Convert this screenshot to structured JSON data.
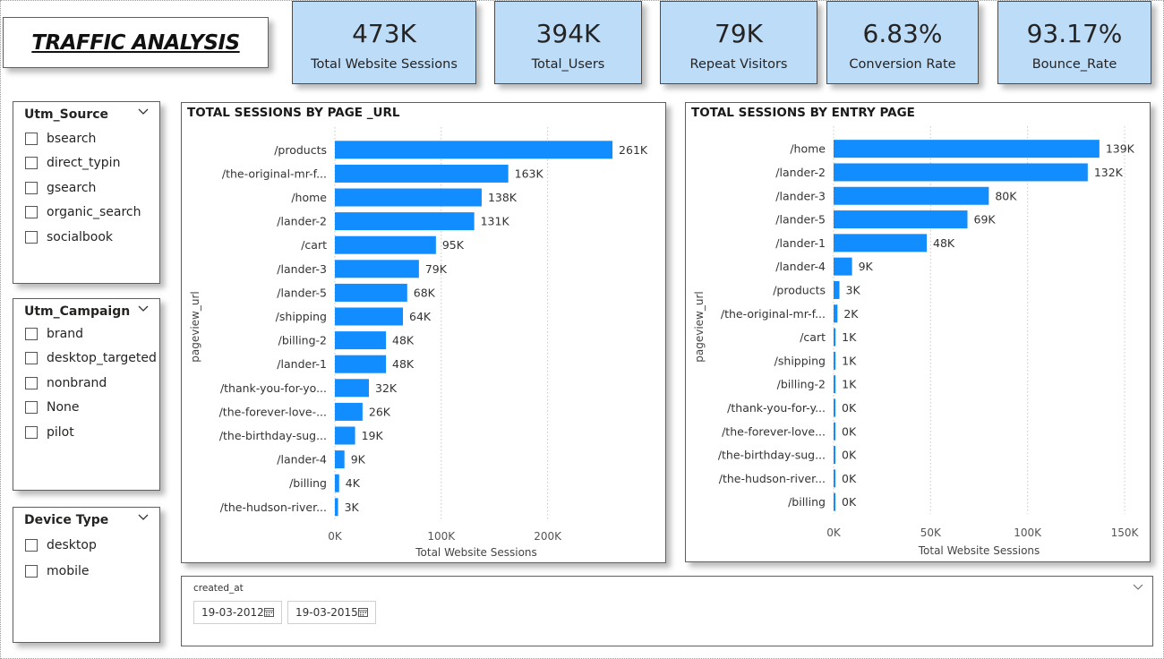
{
  "title": "TRAFFIC ANALYSIS",
  "kpis": [
    {
      "value": "473K",
      "label": "Total Website Sessions"
    },
    {
      "value": "394K",
      "label": "Total_Users"
    },
    {
      "value": "79K",
      "label": "Repeat Visitors"
    },
    {
      "value": "6.83%",
      "label": "Conversion Rate"
    },
    {
      "value": "93.17%",
      "label": "Bounce_Rate"
    }
  ],
  "slicers": {
    "utm_source": {
      "title": "Utm_Source",
      "items": [
        "bsearch",
        "direct_typin",
        "gsearch",
        "organic_search",
        "socialbook"
      ]
    },
    "utm_campaign": {
      "title": "Utm_Campaign",
      "items": [
        "brand",
        "desktop_targeted",
        "nonbrand",
        "None",
        "pilot"
      ]
    },
    "device_type": {
      "title": "Device Type",
      "items": [
        "desktop",
        "mobile"
      ]
    }
  },
  "date_filter": {
    "label": "created_at",
    "start": "19-03-2012",
    "end": "19-03-2015"
  },
  "colors": {
    "bar": "#118dff",
    "kpi_bg": "#bcdcf8"
  },
  "chart_data": [
    {
      "type": "bar",
      "orientation": "horizontal",
      "title": "TOTAL SESSIONS BY PAGE _URL",
      "xlabel": "Total Website Sessions",
      "ylabel": "pageview_url",
      "xlim": [
        0,
        266000
      ],
      "xticks": [
        0,
        100000,
        200000
      ],
      "xtick_labels": [
        "0K",
        "100K",
        "200K"
      ],
      "grid": true,
      "categories": [
        "/products",
        "/the-original-mr-f...",
        "/home",
        "/lander-2",
        "/cart",
        "/lander-3",
        "/lander-5",
        "/shipping",
        "/billing-2",
        "/lander-1",
        "/thank-you-for-yo...",
        "/the-forever-love-...",
        "/the-birthday-sug...",
        "/lander-4",
        "/billing",
        "/the-hudson-river..."
      ],
      "values": [
        261000,
        163000,
        138000,
        131000,
        95000,
        79000,
        68000,
        64000,
        48000,
        48000,
        32000,
        26000,
        19000,
        9000,
        4000,
        3000
      ],
      "data_labels": [
        "261K",
        "163K",
        "138K",
        "131K",
        "95K",
        "79K",
        "68K",
        "64K",
        "48K",
        "48K",
        "32K",
        "26K",
        "19K",
        "9K",
        "4K",
        "3K"
      ]
    },
    {
      "type": "bar",
      "orientation": "horizontal",
      "title": "TOTAL SESSIONS BY ENTRY PAGE",
      "xlabel": "Total Website Sessions",
      "ylabel": "pageview_url",
      "xlim": [
        0,
        150000
      ],
      "xticks": [
        0,
        50000,
        100000,
        150000
      ],
      "xtick_labels": [
        "0K",
        "50K",
        "100K",
        "150K"
      ],
      "grid": true,
      "categories": [
        "/home",
        "/lander-2",
        "/lander-3",
        "/lander-5",
        "/lander-1",
        "/lander-4",
        "/products",
        "/the-original-mr-f...",
        "/cart",
        "/shipping",
        "/billing-2",
        "/thank-you-for-y...",
        "/the-forever-love...",
        "/the-birthday-sug...",
        "/the-hudson-river...",
        "/billing"
      ],
      "values": [
        137000,
        131000,
        80000,
        69000,
        48000,
        9500,
        3000,
        2000,
        1000,
        1000,
        1000,
        200,
        200,
        200,
        200,
        200
      ],
      "data_labels": [
        "139K",
        "132K",
        "80K",
        "69K",
        "48K",
        "9K",
        "3K",
        "2K",
        "1K",
        "1K",
        "1K",
        "0K",
        "0K",
        "0K",
        "0K",
        "0K"
      ]
    }
  ]
}
